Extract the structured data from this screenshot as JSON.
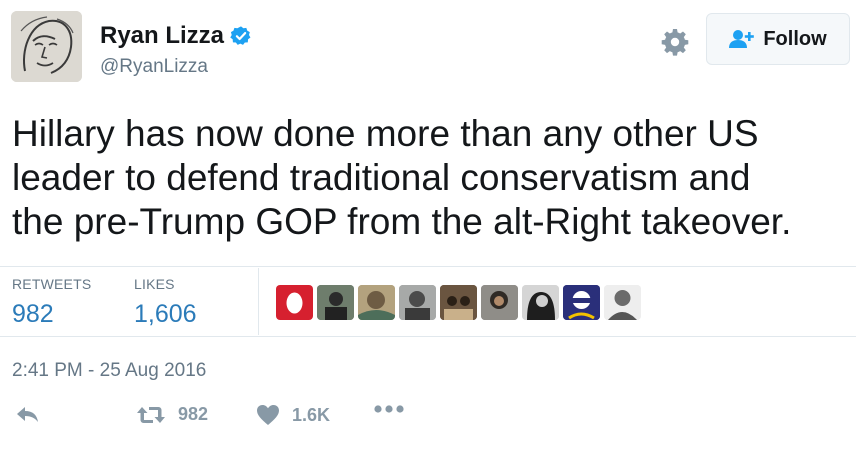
{
  "user": {
    "name": "Ryan Lizza",
    "handle": "@RyanLizza",
    "verified": true,
    "avatar": "sketch-portrait"
  },
  "header": {
    "settings_icon": "gear-icon",
    "follow_label": "Follow",
    "follow_icon": "add-user-icon"
  },
  "tweet": {
    "lines": [
      "Hillary has now done more than any other US",
      "leader to defend traditional conservatism and",
      "the pre-Trump GOP from the alt-Right takeover."
    ]
  },
  "stats": {
    "retweets_label": "RETWEETS",
    "retweets_value": "982",
    "likes_label": "LIKES",
    "likes_value": "1,606"
  },
  "likers_count_shown": 9,
  "timestamp": "2:41 PM - 25 Aug 2016",
  "actions": {
    "reply_icon": "reply-icon",
    "retweet_icon": "retweet-icon",
    "retweet_count": "982",
    "like_icon": "heart-icon",
    "like_count": "1.6K",
    "more_icon": "more-icon"
  },
  "colors": {
    "link_blue": "#2b7bb9",
    "verified_blue": "#1da1f2",
    "muted": "#657786",
    "action_grey": "#8899a6"
  }
}
